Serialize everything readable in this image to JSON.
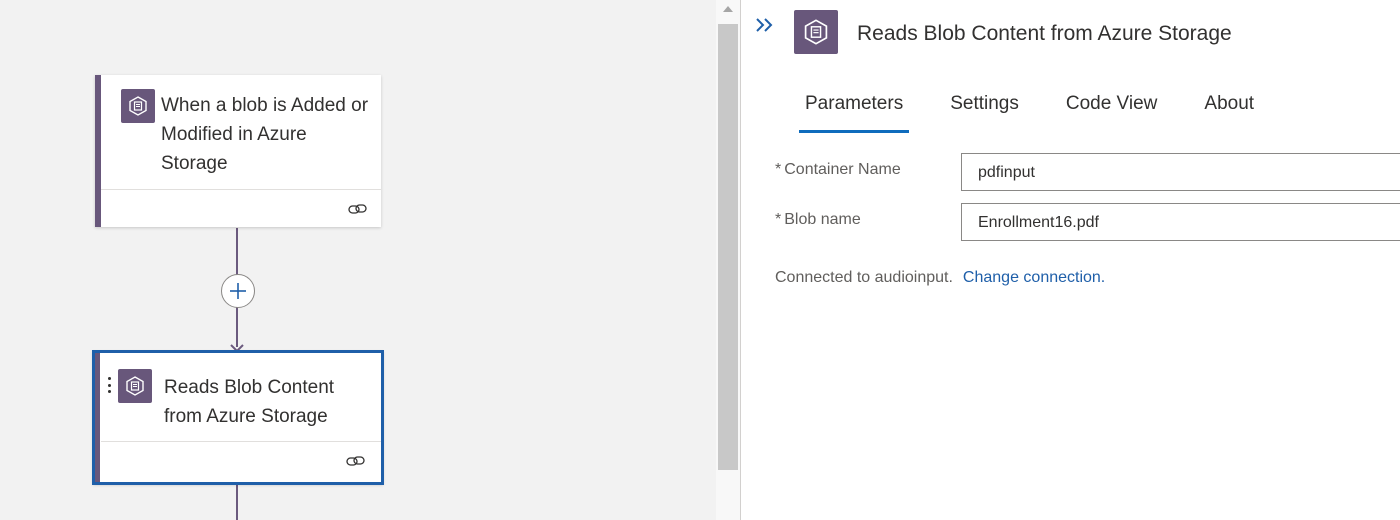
{
  "canvas": {
    "trigger_card": {
      "title": "When a blob is Added or Modified in Azure Storage",
      "icon": "blob-storage-icon",
      "footer_icon": "link-icon"
    },
    "add_step": {
      "icon": "plus-icon"
    },
    "action_card": {
      "title": "Reads Blob Content from Azure Storage",
      "icon": "blob-storage-icon",
      "footer_icon": "link-icon",
      "menu_icon": "more-vertical-icon"
    }
  },
  "panel": {
    "collapse_icon": "double-chevron-right-icon",
    "icon": "blob-storage-icon",
    "title": "Reads Blob Content from Azure Storage",
    "tabs": [
      {
        "label": "Parameters",
        "active": true
      },
      {
        "label": "Settings",
        "active": false
      },
      {
        "label": "Code View",
        "active": false
      },
      {
        "label": "About",
        "active": false
      }
    ],
    "fields": [
      {
        "required_mark": "*",
        "label": "Container Name",
        "value": "pdfinput"
      },
      {
        "required_mark": "*",
        "label": "Blob name",
        "value": "Enrollment16.pdf"
      }
    ],
    "connection": {
      "text": "Connected to audioinput.",
      "link": "Change connection."
    }
  },
  "colors": {
    "accent_purple": "#68577b",
    "selection_blue": "#1f5fa9",
    "tab_underline": "#0f6cbd",
    "canvas_bg": "#f2f2f2"
  }
}
